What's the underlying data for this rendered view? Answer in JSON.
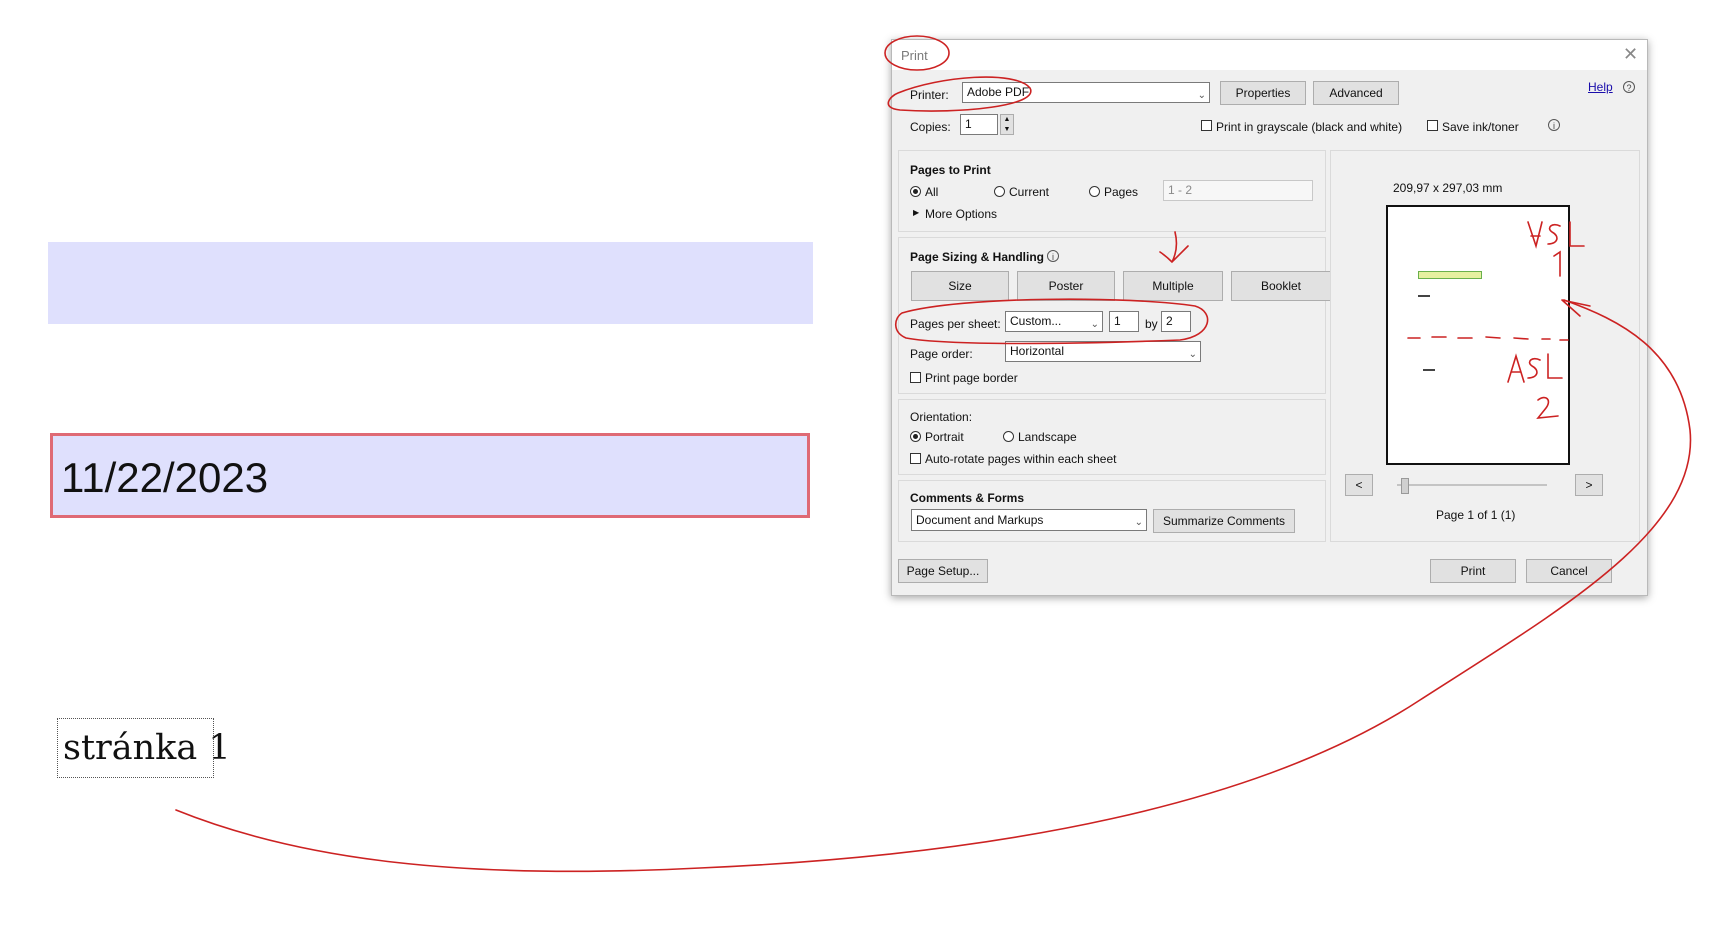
{
  "page": {
    "date_value": "11/22/2023",
    "page_label": "stránka 1"
  },
  "dialog": {
    "title": "Print",
    "help_label": "Help",
    "printer_label": "Printer:",
    "printer_value": "Adobe PDF",
    "properties_label": "Properties",
    "advanced_label": "Advanced",
    "copies_label": "Copies:",
    "copies_value": "1",
    "grayscale_label": "Print in grayscale (black and white)",
    "save_ink_label": "Save ink/toner",
    "pages_to_print": {
      "heading": "Pages to Print",
      "all_label": "All",
      "current_label": "Current",
      "pages_label": "Pages",
      "pages_range_value": "1 - 2",
      "more_options_label": "More Options"
    },
    "sizing": {
      "heading": "Page Sizing & Handling",
      "size_label": "Size",
      "poster_label": "Poster",
      "multiple_label": "Multiple",
      "booklet_label": "Booklet",
      "pages_per_sheet_label": "Pages per sheet:",
      "pages_per_sheet_value": "Custom...",
      "cols_value": "1",
      "by_label": "by",
      "rows_value": "2",
      "page_order_label": "Page order:",
      "page_order_value": "Horizontal",
      "print_border_label": "Print page border"
    },
    "orientation": {
      "heading": "Orientation:",
      "portrait_label": "Portrait",
      "landscape_label": "Landscape",
      "auto_rotate_label": "Auto-rotate pages within each sheet"
    },
    "comments": {
      "heading": "Comments & Forms",
      "value": "Document and Markups",
      "summarize_label": "Summarize Comments"
    },
    "preview": {
      "dimensions": "209,97 x 297,03 mm",
      "prev_label": "<",
      "next_label": ">",
      "page_info": "Page 1 of 1 (1)"
    },
    "page_setup_label": "Page Setup...",
    "print_label": "Print",
    "cancel_label": "Cancel"
  },
  "annotations": {
    "label_top": "A5L 1",
    "label_bottom": "A5L 2",
    "color": "#cc2222"
  }
}
